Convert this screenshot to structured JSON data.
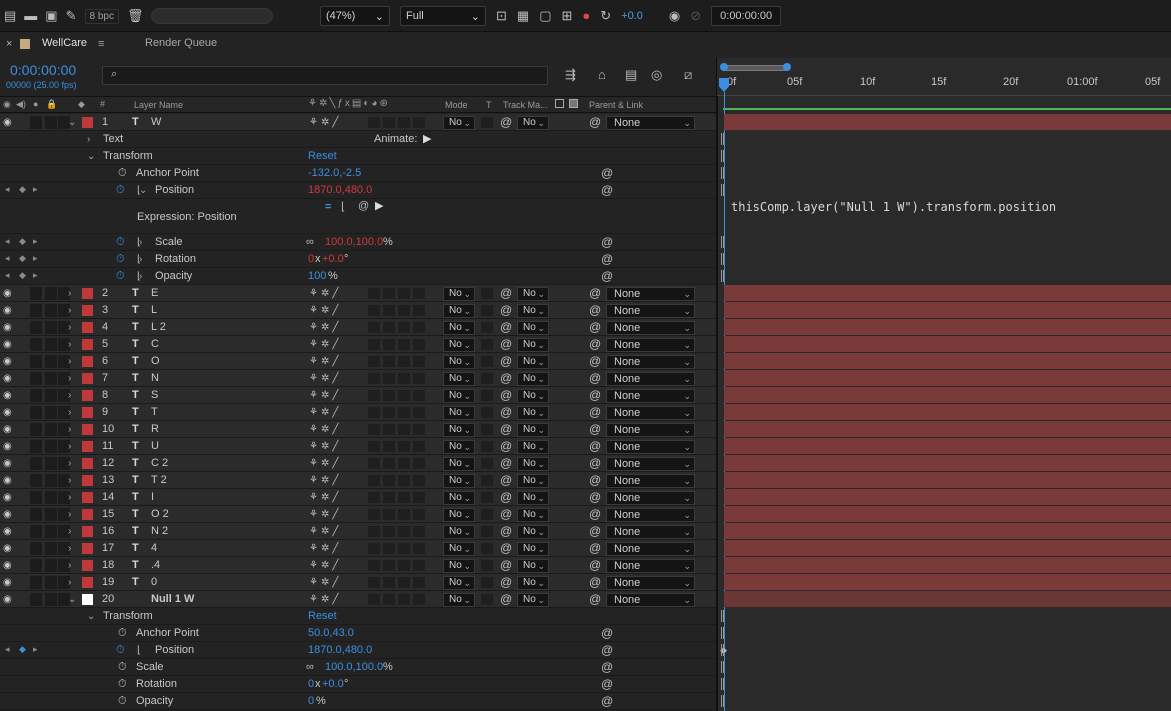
{
  "toolbar": {
    "bpc": "8 bpc",
    "zoom": "(47%)",
    "resolution": "Full",
    "exposure": "+0.0",
    "timecode": "0:00:00:00"
  },
  "tabs": {
    "comp": "WellCare",
    "render": "Render Queue"
  },
  "time": {
    "current": "0:00:00:00",
    "frames": "00000 (25.00 fps)",
    "search_placeholder": "⌕"
  },
  "ruler": {
    "ticks": [
      "0f",
      "05f",
      "10f",
      "15f",
      "20f",
      "01:00f",
      "05f"
    ]
  },
  "headers": {
    "layer_name": "Layer Name",
    "mode": "Mode",
    "t": "T",
    "track_matte": "Track Ma...",
    "parent": "Parent & Link"
  },
  "labels": {
    "text": "Text",
    "animate": "Animate:",
    "transform": "Transform",
    "reset": "Reset",
    "anchor": "Anchor Point",
    "position": "Position",
    "scale": "Scale",
    "rotation": "Rotation",
    "opacity": "Opacity",
    "expression": "Expression: Position",
    "mode_val": "No",
    "track_val": "No",
    "parent_val": "None",
    "percent": "%",
    "x": "x",
    "deg": "°"
  },
  "layer1": {
    "num": "1",
    "name": "W",
    "anchor": "-132.0,-2.5",
    "position": "1870.0,480.0",
    "scale": "100.0,100.0",
    "rot_rev": "0",
    "rot_deg": "+0.0",
    "opacity": "100",
    "expression_code": "thisComp.layer(\"Null 1 W\").transform.position"
  },
  "layers": [
    {
      "num": "2",
      "name": "E"
    },
    {
      "num": "3",
      "name": "L"
    },
    {
      "num": "4",
      "name": "L 2"
    },
    {
      "num": "5",
      "name": "C"
    },
    {
      "num": "6",
      "name": "O"
    },
    {
      "num": "7",
      "name": "N"
    },
    {
      "num": "8",
      "name": "S"
    },
    {
      "num": "9",
      "name": "T"
    },
    {
      "num": "10",
      "name": "R"
    },
    {
      "num": "11",
      "name": "U"
    },
    {
      "num": "12",
      "name": "C 2"
    },
    {
      "num": "13",
      "name": "T 2"
    },
    {
      "num": "14",
      "name": "I"
    },
    {
      "num": "15",
      "name": "O 2"
    },
    {
      "num": "16",
      "name": "N 2"
    },
    {
      "num": "17",
      "name": "4"
    },
    {
      "num": "18",
      "name": ".4"
    },
    {
      "num": "19",
      "name": "0"
    }
  ],
  "layer20": {
    "num": "20",
    "name": "Null 1 W",
    "anchor": "50.0,43.0",
    "position": "1870.0,480.0",
    "scale": "100.0,100.0",
    "rot_rev": "0",
    "rot_deg": "+0.0",
    "opacity": "0"
  }
}
